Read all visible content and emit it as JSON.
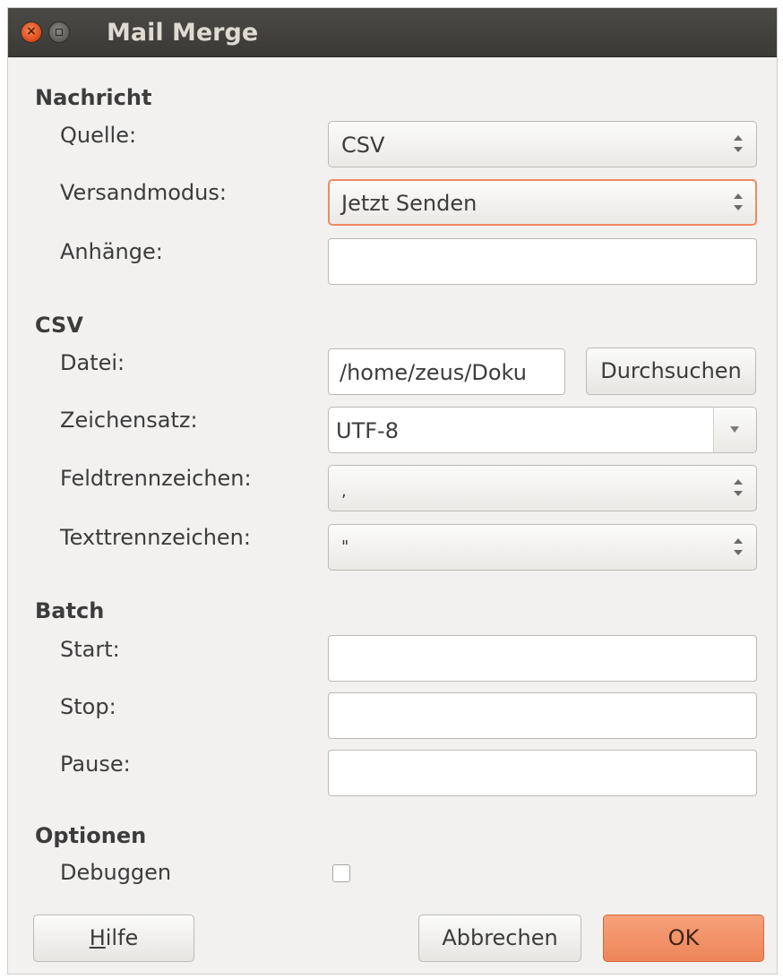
{
  "window": {
    "title": "Mail Merge"
  },
  "titlebar": {
    "close_icon_glyph": "×"
  },
  "nachricht": {
    "heading": "Nachricht",
    "quelle_label": "Quelle:",
    "quelle_value": "CSV",
    "versandmodus_label": "Versandmodus:",
    "versandmodus_value": "Jetzt Senden",
    "anhaenge_label": "Anhänge:",
    "anhaenge_value": ""
  },
  "csv": {
    "heading": "CSV",
    "datei_label": "Datei:",
    "datei_value": "/home/zeus/Doku",
    "browse_label": "Durchsuchen",
    "zeichensatz_label": "Zeichensatz:",
    "zeichensatz_value": "UTF-8",
    "feldtrenn_label": "Feldtrennzeichen:",
    "feldtrenn_value": ",",
    "texttrenn_label": "Texttrennzeichen:",
    "texttrenn_value": "\""
  },
  "batch": {
    "heading": "Batch",
    "start_label": "Start:",
    "stop_label": "Stop:",
    "pause_label": "Pause:"
  },
  "optionen": {
    "heading": "Optionen",
    "debug_label": "Debuggen",
    "debug_checked": false
  },
  "buttons": {
    "help_mnemonic": "H",
    "help_rest": "ilfe",
    "cancel": "Abbrechen",
    "ok": "OK"
  },
  "colors": {
    "accent": "#ef8559",
    "focus_border": "#ef8a5f",
    "titlebar": "#3f3e3a",
    "dialog_bg": "#f2f1f0"
  }
}
